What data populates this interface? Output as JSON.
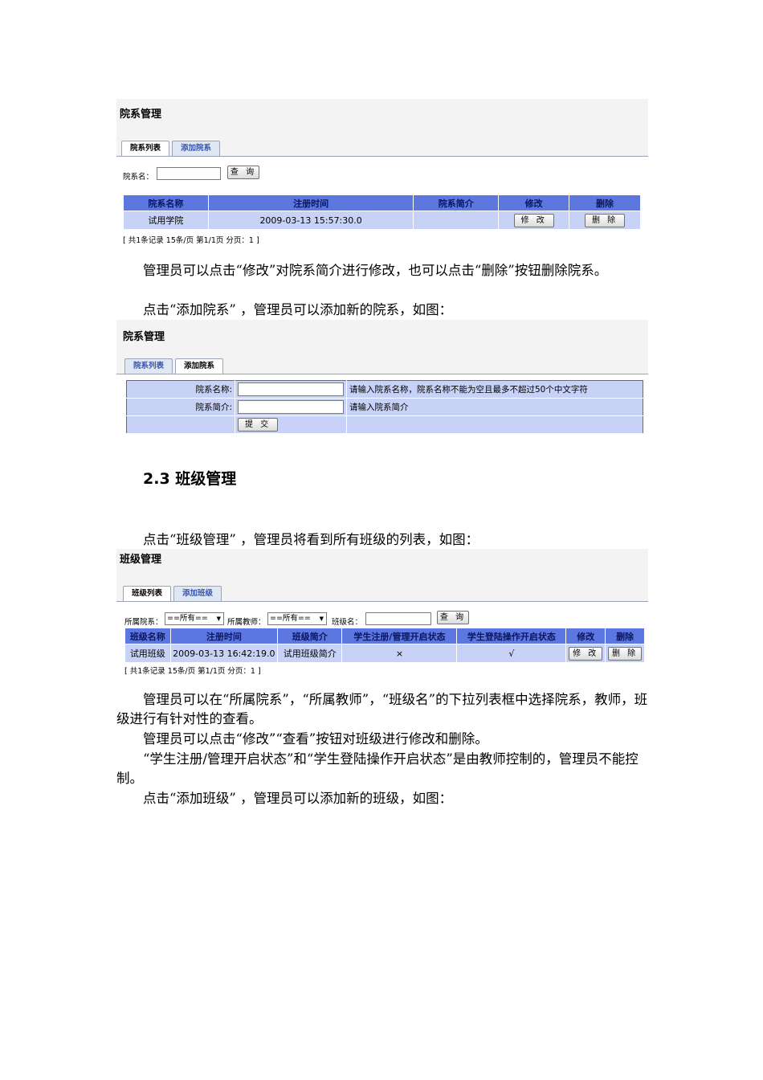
{
  "shot1": {
    "title": "院系管理",
    "tabs": [
      "院系列表",
      "添加院系"
    ],
    "search_label": "院系名：",
    "search_button": "查 询",
    "columns": [
      "院系名称",
      "注册时间",
      "院系简介",
      "修改",
      "删除"
    ],
    "row": {
      "name": "试用学院",
      "time": "2009-03-13 15:57:30.0",
      "intro": "",
      "edit": "修 改",
      "delete": "删 除"
    },
    "pager": "[ 共1条记录 15条/页 第1/1页 分页：1 ]"
  },
  "para1": "管理员可以点击“修改”对院系简介进行修改，也可以点击“删除”按钮删除院系。",
  "para2": "点击“添加院系” ，管理员可以添加新的院系，如图：",
  "shot2": {
    "title": "院系管理",
    "tabs": [
      "院系列表",
      "添加院系"
    ],
    "fields": [
      {
        "label": "院系名称:",
        "hint": "请输入院系名称，院系名称不能为空且最多不超过50个中文字符"
      },
      {
        "label": "院系简介:",
        "hint": "请输入院系简介"
      }
    ],
    "submit": "提 交"
  },
  "heading": "2.3 班级管理",
  "para3": "点击“班级管理” ，管理员将看到所有班级的列表，如图：",
  "shot3": {
    "title": "班级管理",
    "tabs": [
      "班级列表",
      "添加班级"
    ],
    "filter_college_label": "所属院系：",
    "filter_college_value": "==所有==",
    "filter_teacher_label": "所属教师：",
    "filter_teacher_value": "==所有==",
    "filter_class_label": "班级名：",
    "search_button": "查 询",
    "columns": [
      "班级名称",
      "注册时间",
      "班级简介",
      "学生注册/管理开启状态",
      "学生登陆操作开启状态",
      "修改",
      "删除"
    ],
    "row": {
      "name": "试用班级",
      "time": "2009-03-13 16:42:19.0",
      "intro": "试用班级简介",
      "reg": "×",
      "login": "√",
      "edit": "修 改",
      "delete": "删 除"
    },
    "pager": "[ 共1条记录 15条/页 第1/1页 分页：1 ]"
  },
  "para4": "管理员可以在“所属院系”，“所属教师”，“班级名”的下拉列表框中选择院系，教师，班级进行有针对性的查看。",
  "para5": "管理员可以点击“修改”“查看”按钮对班级进行修改和删除。",
  "para6": "“学生注册/管理开启状态”和“学生登陆操作开启状态”是由教师控制的，管理员不能控制。",
  "para7": "点击“添加班级” ，管理员可以添加新的班级，如图："
}
